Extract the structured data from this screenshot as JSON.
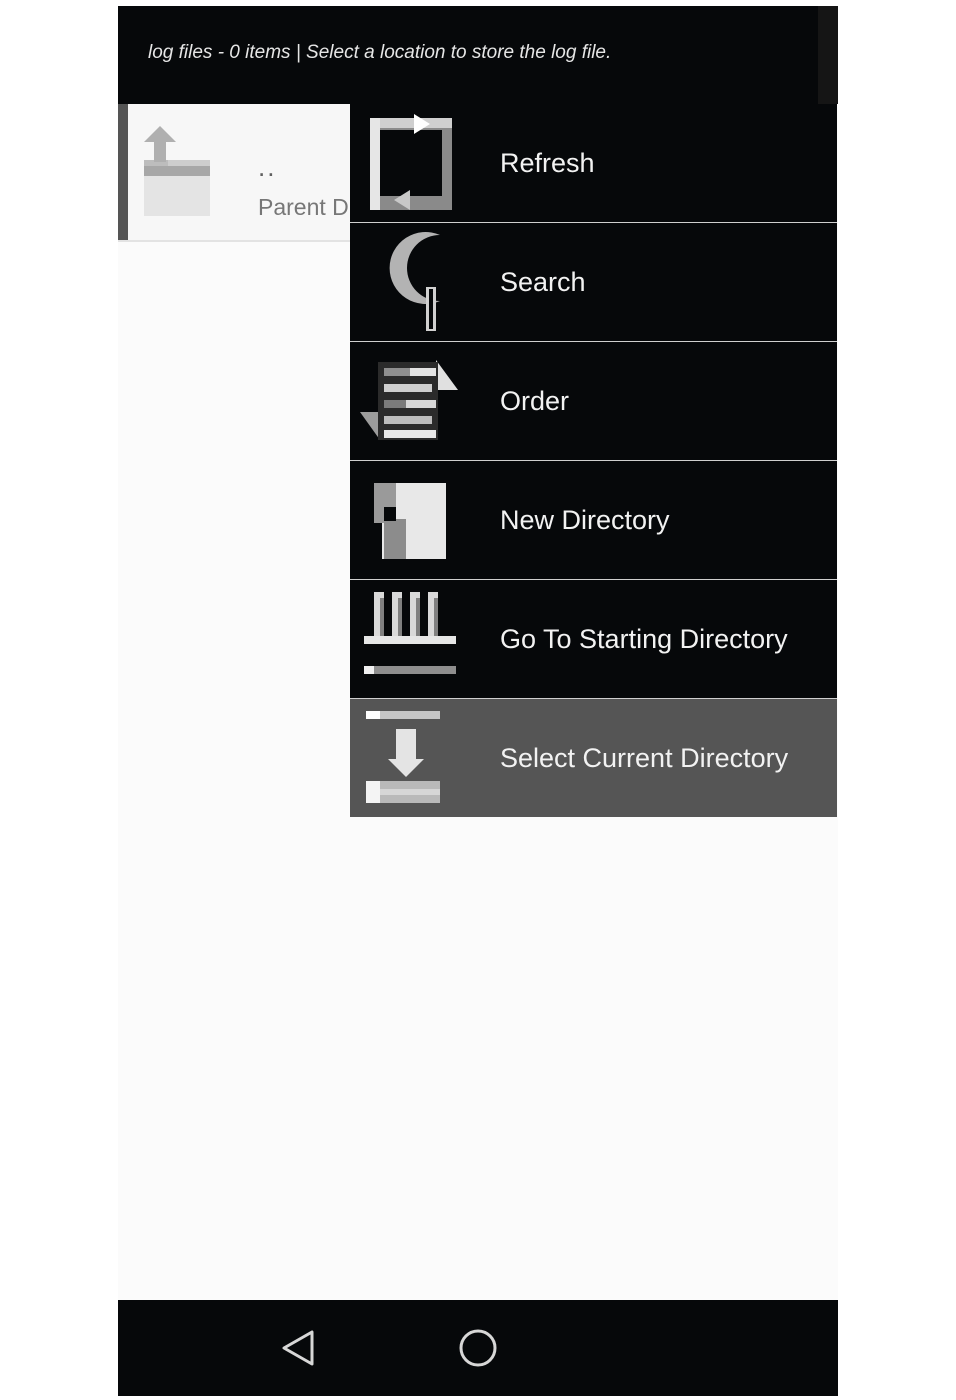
{
  "header": {
    "title": "log files - 0 items | Select a location to store the log file."
  },
  "list": {
    "items": [
      {
        "name": "..",
        "label": "Parent D",
        "icon": "folder-up-icon"
      }
    ]
  },
  "menu": {
    "items": [
      {
        "label": "Refresh",
        "icon": "refresh-icon"
      },
      {
        "label": "Search",
        "icon": "search-icon"
      },
      {
        "label": "Order",
        "icon": "order-icon"
      },
      {
        "label": "New Directory",
        "icon": "new-directory-icon"
      },
      {
        "label": "Go To Starting Directory",
        "icon": "home-directory-icon"
      },
      {
        "label": "Select Current Directory",
        "icon": "select-directory-icon",
        "selected": true
      }
    ]
  },
  "navbar": {
    "buttons": [
      {
        "name": "back",
        "icon": "back-triangle-icon"
      },
      {
        "name": "home",
        "icon": "home-circle-icon"
      }
    ]
  },
  "colors": {
    "header_bg": "#06080a",
    "menu_bg": "#06080a",
    "selected_bg": "#555555",
    "content_bg": "#fbfbfb"
  }
}
